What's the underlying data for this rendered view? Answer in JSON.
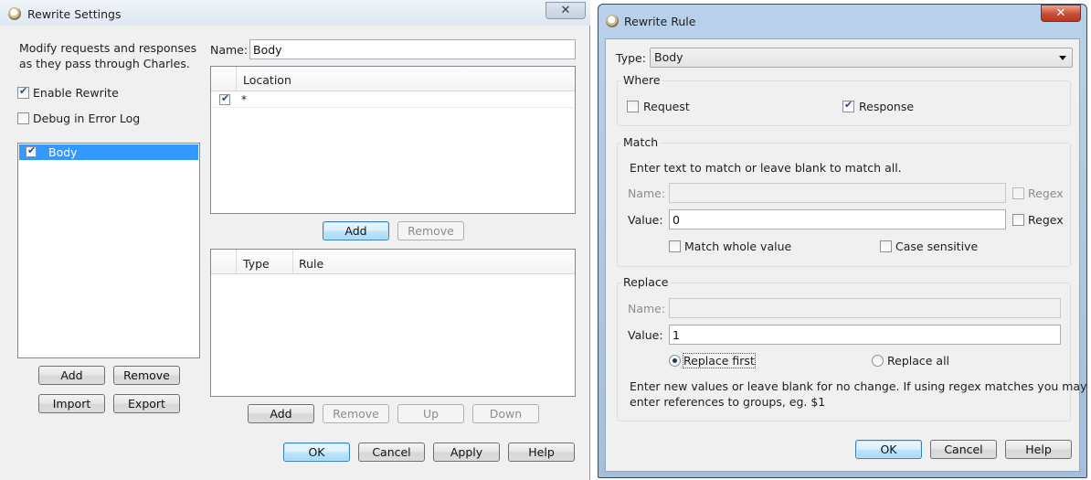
{
  "rewrite_settings": {
    "title": "Rewrite Settings",
    "close_label": "✕",
    "description_line1": "Modify requests and responses",
    "description_line2": "as they pass through Charles.",
    "enable_rewrite": {
      "label": "Enable Rewrite",
      "checked": true
    },
    "debug_log": {
      "label": "Debug in Error Log",
      "checked": false
    },
    "sets": [
      {
        "label": "Body",
        "checked": true,
        "selected": true
      }
    ],
    "set_buttons": {
      "add": "Add",
      "remove": "Remove",
      "import": "Import",
      "export": "Export"
    },
    "name_label": "Name:",
    "name_value": "Body",
    "locations": {
      "header": "Location",
      "rows": [
        {
          "checked": true,
          "value": "*"
        }
      ],
      "add": "Add",
      "remove": "Remove"
    },
    "rules": {
      "headers": [
        "Type",
        "Rule"
      ],
      "add": "Add",
      "remove": "Remove",
      "up": "Up",
      "down": "Down"
    },
    "footer": {
      "ok": "OK",
      "cancel": "Cancel",
      "apply": "Apply",
      "help": "Help"
    }
  },
  "rewrite_rule": {
    "title": "Rewrite Rule",
    "close_label": "✕",
    "type_label": "Type:",
    "type_value": "Body",
    "where": {
      "title": "Where",
      "request": {
        "label": "Request",
        "checked": false
      },
      "response": {
        "label": "Response",
        "checked": true
      }
    },
    "match": {
      "title": "Match",
      "hint": "Enter text to match or leave blank to match all.",
      "name_label": "Name:",
      "name_value": "",
      "name_regex": "Regex",
      "value_label": "Value:",
      "value_value": "0",
      "value_regex": "Regex",
      "whole_value": "Match whole value",
      "case_sensitive": "Case sensitive"
    },
    "replace": {
      "title": "Replace",
      "name_label": "Name:",
      "name_value": "",
      "value_label": "Value:",
      "value_value": "1",
      "replace_first": "Replace first",
      "replace_all": "Replace all",
      "selected": "Replace first",
      "hint_line1": "Enter new values or leave blank for no change. If using regex matches you may",
      "hint_line2": "enter references to groups, eg. $1"
    },
    "footer": {
      "ok": "OK",
      "cancel": "Cancel",
      "help": "Help"
    }
  }
}
